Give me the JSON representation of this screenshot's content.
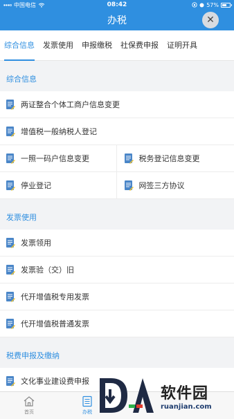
{
  "status_bar": {
    "carrier": "中国电信",
    "time": "08:42",
    "battery": "57%",
    "battery_level": 0.57
  },
  "header": {
    "title": "办税",
    "close_symbol": "✕"
  },
  "tabs": [
    {
      "label": "综合信息",
      "active": true
    },
    {
      "label": "发票使用",
      "active": false
    },
    {
      "label": "申报缴税",
      "active": false
    },
    {
      "label": "社保费申报",
      "active": false
    },
    {
      "label": "证明开具",
      "active": false
    }
  ],
  "sections": {
    "general": {
      "title": "综合信息",
      "items": [
        "两证整合个体工商户信息变更",
        "增值税一般纳税人登记",
        "一照一码户信息变更",
        "税务登记信息变更",
        "停业登记",
        "网签三方协议"
      ]
    },
    "invoice": {
      "title": "发票使用",
      "items": [
        "发票领用",
        "发票验（交）旧",
        "代开增值税专用发票",
        "代开增值税普通发票"
      ]
    },
    "tax": {
      "title": "税费申报及缴纳",
      "items": [
        "文化事业建设费申报"
      ]
    }
  },
  "bottom_tabs": [
    {
      "label": "首页",
      "icon": "home-icon",
      "active": false
    },
    {
      "label": "办税",
      "icon": "list-icon",
      "active": true
    }
  ],
  "watermark": {
    "text": "软件园",
    "url": "ruanjian.com"
  },
  "colors": {
    "accent": "#2f8fe0",
    "icon_blue": "#4a86c8",
    "icon_yellow": "#f2c530"
  }
}
